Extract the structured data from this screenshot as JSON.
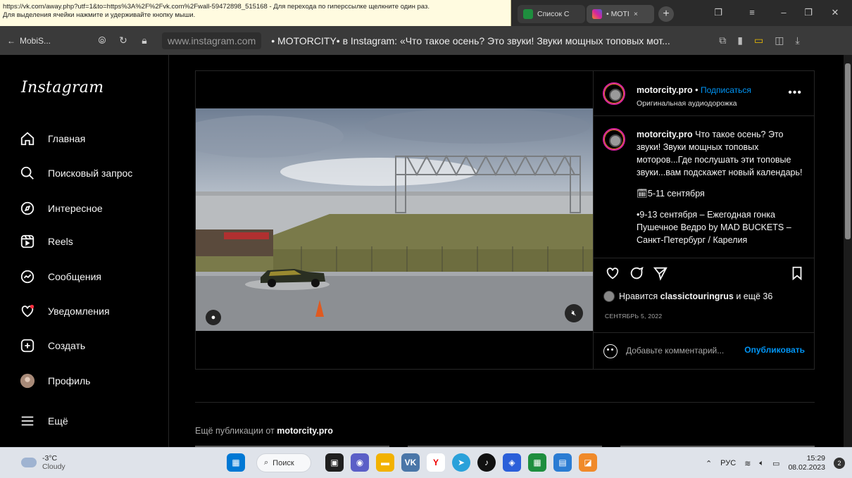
{
  "statusbar": {
    "line1": "https://vk.com/away.php?utf=1&to=https%3A%2F%2Fvk.com%2Fwall-59472898_515168 - Для перехода по гиперссылке щелкните один раз.",
    "line2": "Для выделения ячейки нажмите и удерживайте кнопку мыши."
  },
  "tabs": [
    {
      "label": "Список С",
      "color": "#1e8e3e"
    },
    {
      "label": "• MOTI",
      "color": "#d6249f"
    }
  ],
  "browser": {
    "back_label": "MobiS...",
    "domain": "www.instagram.com",
    "page_title": "• MOTORCITY• в Instagram: «Что такое осень? Это звуки! Звуки мощных топовых мот..."
  },
  "sidebar": {
    "logo": "Instagram",
    "items": [
      {
        "label": "Главная",
        "icon": "home-icon"
      },
      {
        "label": "Поисковый запрос",
        "icon": "search-icon"
      },
      {
        "label": "Интересное",
        "icon": "compass-icon"
      },
      {
        "label": "Reels",
        "icon": "reels-icon"
      },
      {
        "label": "Сообщения",
        "icon": "messenger-icon"
      },
      {
        "label": "Уведомления",
        "icon": "heart-icon"
      },
      {
        "label": "Создать",
        "icon": "plus-square-icon"
      },
      {
        "label": "Профиль",
        "icon": "avatar-icon"
      },
      {
        "label": "Ещё",
        "icon": "menu-icon"
      }
    ]
  },
  "post": {
    "username": "motorcity.pro",
    "separator": "•",
    "follow_label": "Подписаться",
    "audio": "Оригинальная аудиодорожка",
    "caption_user": "motorcity.pro",
    "caption_lines": [
      "Что такое осень? Это звуки! Звуки мощных топовых моторов...Где послушать эти топовые звуки...вам подскажет новый календарь!",
      "🗓5-11 сентября",
      "•9-13 сентября – Ежегодная гонка Пушечное Ведро by MAD BUCKETS – Санкт-Петербург / Карелия"
    ],
    "likes_prefix": "Нравится ",
    "likes_user": "classictouringrus",
    "likes_suffix": " и ещё 36",
    "date": "СЕНТЯБРЬ 5, 2022",
    "comment_placeholder": "Добавьте комментарий...",
    "publish_label": "Опубликовать"
  },
  "more": {
    "prefix": "Ещё публикации от ",
    "user": "motorcity.pro"
  },
  "taskbar": {
    "temp": "-3°C",
    "condition": "Cloudy",
    "search_label": "Поиск",
    "lang": "РУС",
    "time": "15:29",
    "date": "08.02.2023"
  }
}
